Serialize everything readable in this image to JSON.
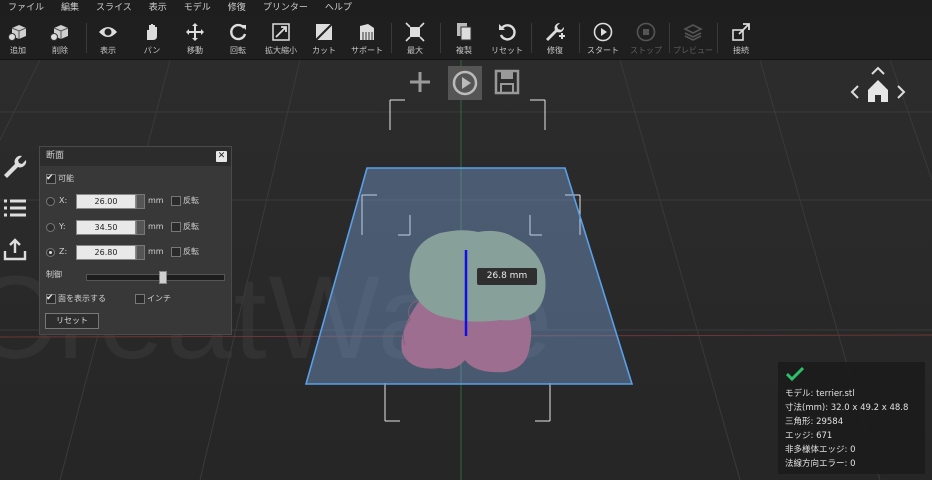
{
  "menu": [
    "ファイル",
    "編集",
    "スライス",
    "表示",
    "モデル",
    "修復",
    "プリンター",
    "ヘルプ"
  ],
  "toolbar": [
    {
      "label": "追加",
      "icon": "cube-add-icon"
    },
    {
      "label": "削除",
      "icon": "cube-delete-icon"
    },
    {
      "label": "表示",
      "icon": "eye-icon"
    },
    {
      "label": "パン",
      "icon": "hand-icon"
    },
    {
      "label": "移動",
      "icon": "move-icon"
    },
    {
      "label": "回転",
      "icon": "rotate-icon"
    },
    {
      "label": "拡大縮小",
      "icon": "scale-icon"
    },
    {
      "label": "カット",
      "icon": "cut-icon"
    },
    {
      "label": "サポート",
      "icon": "support-icon"
    },
    {
      "label": "最大",
      "icon": "maximize-icon"
    },
    {
      "label": "複製",
      "icon": "duplicate-icon"
    },
    {
      "label": "リセット",
      "icon": "reset-icon"
    },
    {
      "label": "修復",
      "icon": "repair-icon"
    },
    {
      "label": "スタート",
      "icon": "play-icon"
    },
    {
      "label": "ストップ",
      "icon": "stop-icon",
      "disabled": true
    },
    {
      "label": "プレビュー",
      "icon": "layers-icon",
      "disabled": true
    },
    {
      "label": "接続",
      "icon": "connect-icon"
    }
  ],
  "section_panel": {
    "title": "断面",
    "close": "✕",
    "enable_label": "可能",
    "axes": [
      {
        "label": "X:",
        "value": "26.00",
        "unit": "mm",
        "flip": "反転",
        "selected": false
      },
      {
        "label": "Y:",
        "value": "34.50",
        "unit": "mm",
        "flip": "反転",
        "selected": false
      },
      {
        "label": "Z:",
        "value": "26.80",
        "unit": "mm",
        "flip": "反転",
        "selected": true
      }
    ],
    "control_label": "制御",
    "slider_fraction": 0.55,
    "show_face_label": "面を表示する",
    "inch_label": "インチ",
    "reset_label": "リセット"
  },
  "viewport": {
    "watermark": "CreatWare",
    "measure_label": "26.8  mm"
  },
  "info": {
    "model": "モデル: terrier.stl",
    "size": "寸法(mm): 32.0 x 49.2 x 48.8",
    "triangles": "三角形: 29584",
    "edges": "エッジ: 671",
    "non_manifold": "非多様体エッジ: 0",
    "normal_errors": "法線方向エラー: 0"
  },
  "colors": {
    "accent_blue": "#5aa0e8",
    "model_green": "#8c9a6c",
    "model_red": "#b04a5c",
    "check_green": "#2fbf6a"
  }
}
